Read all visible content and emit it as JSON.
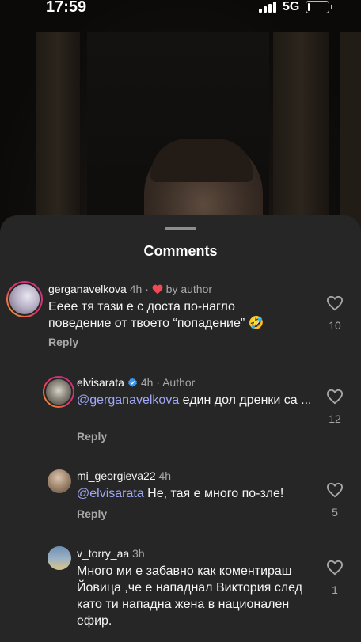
{
  "status_bar": {
    "time": "17:59",
    "network": "5G",
    "battery_level": 0.1
  },
  "sheet": {
    "title": "Comments"
  },
  "colors": {
    "sheet_bg": "#262626",
    "heart": "#ed4956",
    "mention": "#a0a8f5",
    "verified": "#3897f0"
  },
  "comments": [
    {
      "username": "gerganavelkova",
      "time": "4h",
      "liked_by_author": true,
      "author_label": "by author",
      "text": "Еееe тя тази е с доста по-нагло поведение от твоето “попадение” 🤣",
      "reply_label": "Reply",
      "likes": "10"
    },
    {
      "username": "elvisarata",
      "verified": true,
      "time": "4h",
      "author_tag": "Author",
      "mention": "@gerganavelkova",
      "text": " един дол дренки са ...",
      "reply_label": "Reply",
      "likes": "12"
    },
    {
      "username": "mi_georgieva22",
      "time": "4h",
      "mention": "@elvisarata",
      "text": " Не, тая е много по-зле!",
      "reply_label": "Reply",
      "likes": "5"
    },
    {
      "username": "v_torry_aa",
      "time": "3h",
      "text": "Много ми е забавно как коментираш Йовица ,че е нападнал Виктория след като ти нападна жена в национален ефир.",
      "likes": "1"
    }
  ]
}
